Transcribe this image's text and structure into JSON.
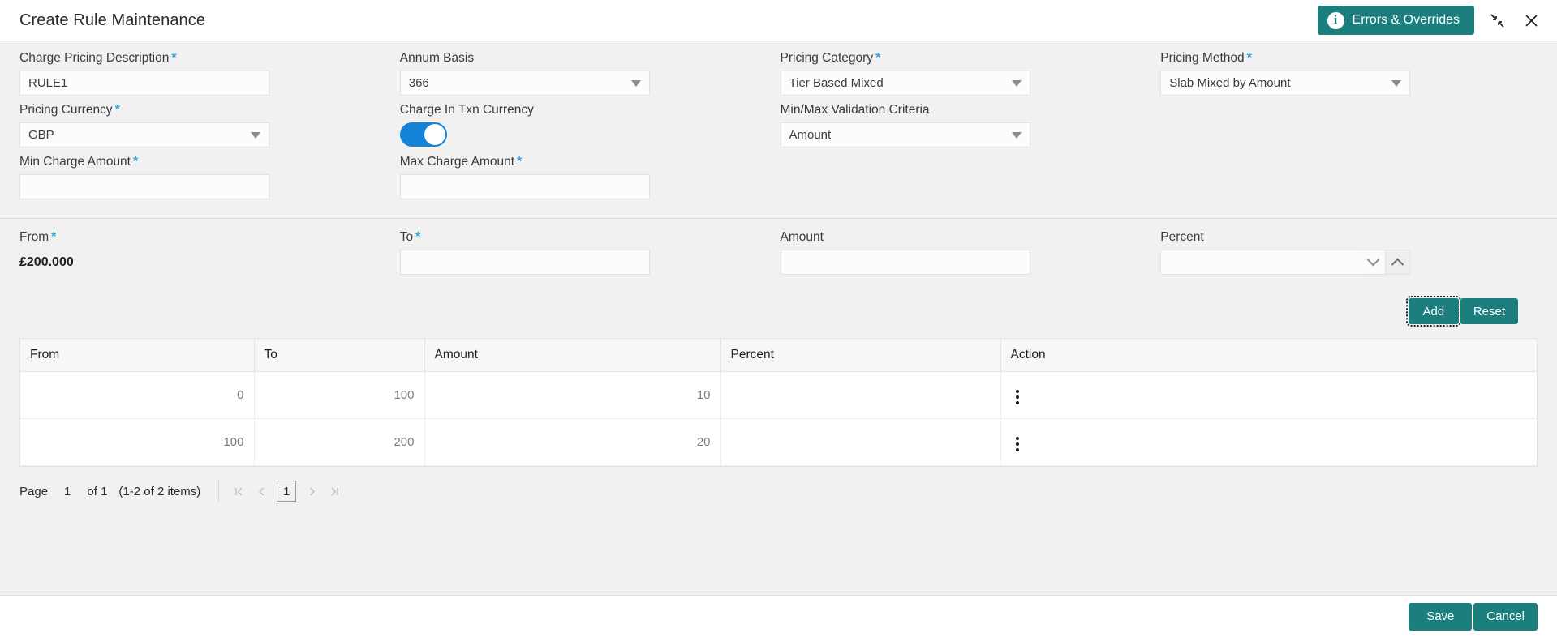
{
  "window": {
    "title": "Create Rule Maintenance",
    "errors_button": "Errors & Overrides",
    "info_icon": "info-icon",
    "minimize_icon": "collapse-icon",
    "close_icon": "close-icon",
    "accent_color": "#1d7e7e",
    "required_color": "#2ba6e0",
    "toggle_on_color": "#1283d6"
  },
  "form": {
    "charge_pricing_description": {
      "label": "Charge Pricing Description",
      "required": true,
      "value": "RULE1"
    },
    "annum_basis": {
      "label": "Annum Basis",
      "required": false,
      "value": "366"
    },
    "pricing_category": {
      "label": "Pricing Category",
      "required": true,
      "value": "Tier Based Mixed"
    },
    "pricing_method": {
      "label": "Pricing Method",
      "required": true,
      "value": "Slab Mixed by Amount"
    },
    "pricing_currency": {
      "label": "Pricing Currency",
      "required": true,
      "value": "GBP"
    },
    "charge_in_txn_currency": {
      "label": "Charge In Txn Currency",
      "state": "on"
    },
    "min_max_validation_criteria": {
      "label": "Min/Max Validation Criteria",
      "required": false,
      "value": "Amount"
    },
    "min_charge_amount": {
      "label": "Min Charge Amount",
      "required": true,
      "value": ""
    },
    "max_charge_amount": {
      "label": "Max Charge Amount",
      "required": true,
      "value": ""
    }
  },
  "range_entry": {
    "from": {
      "label": "From",
      "required": true,
      "value": "£200.000"
    },
    "to": {
      "label": "To",
      "required": true,
      "value": ""
    },
    "amount": {
      "label": "Amount",
      "required": false,
      "value": ""
    },
    "percent": {
      "label": "Percent",
      "required": false,
      "value": ""
    },
    "add_button": "Add",
    "reset_button": "Reset"
  },
  "table": {
    "columns": [
      "From",
      "To",
      "Amount",
      "Percent",
      "Action"
    ],
    "rows": [
      {
        "from": "0",
        "to": "100",
        "amount": "10",
        "percent": "",
        "action": "kebab-menu-icon"
      },
      {
        "from": "100",
        "to": "200",
        "amount": "20",
        "percent": "",
        "action": "kebab-menu-icon"
      }
    ]
  },
  "pagination": {
    "page_label": "Page",
    "page_number": "1",
    "of_text": "of 1",
    "items_text": "(1-2 of 2 items)",
    "first_icon": "⧏|",
    "prev_icon": "‹",
    "current_page": "1",
    "next_icon": "›",
    "last_icon": "|⧐"
  },
  "footer": {
    "save_button": "Save",
    "cancel_button": "Cancel"
  }
}
